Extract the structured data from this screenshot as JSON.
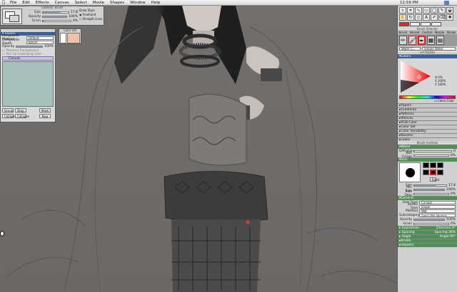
{
  "menubar": {
    "items": [
      "File",
      "Edit",
      "Effects",
      "Canvas",
      "Select",
      "Movie",
      "Shapes",
      "Window",
      "Help"
    ],
    "clock": "12:59 PM"
  },
  "brush_props": {
    "title": "Controls: Brush",
    "rows": [
      {
        "label": "Size",
        "value": "17.8"
      },
      {
        "label": "Opacity",
        "value": "100%"
      },
      {
        "label": "Grain",
        "value": "0%"
      }
    ],
    "draw_style": {
      "title": "Draw Style",
      "opt1": "Freehand",
      "opt2": "Straight Lines"
    }
  },
  "layers": {
    "title": "Layers",
    "composite_method": {
      "label": "Composite Method",
      "value": "Default"
    },
    "composite_depth": {
      "label": "Composite Depth",
      "value": "Ignore"
    },
    "opacity_label": "Opacity",
    "opacity_value": "100%",
    "preserve": "Preserve Transparency",
    "pick_up": "Pick Up Underlying Color",
    "layer_name": "Canvas",
    "buttons": [
      "Group",
      "Drop",
      "Mask",
      "Collapse",
      "Collapse",
      "New"
    ]
  },
  "color_set": {
    "title": "Color Set"
  },
  "right": {
    "palette_title": "Brush Selector",
    "brush_tabs": [
      "Brush",
      "Variant",
      "Control",
      "Nozzle",
      "Stroke"
    ],
    "brush_category": "Water C...",
    "brush_variant": "Simple Water",
    "art_palette": "Art Palette",
    "colors_title": "Colors",
    "hsv": [
      "H 0%",
      "S 100%",
      "V 100%"
    ],
    "clone_color": "Clone Color",
    "sections": [
      "Papers",
      "Gradients",
      "Patterns",
      "Weaves",
      "RGB Color",
      "Color Set",
      "Color Variability",
      "Nozzles",
      "Looks"
    ],
    "brush_controls": "Brush Controls",
    "water_title": "Water",
    "diffusion": {
      "label": "Diffusion",
      "value": "0"
    },
    "wet_fringe": {
      "label": "Wet Fringe",
      "value": "0%"
    },
    "size_title": "Size",
    "size_rows": [
      {
        "label": "Size",
        "value": "17.8"
      },
      {
        "label": "Min Size",
        "value": "100%"
      },
      {
        "label": "Size Step",
        "value": "0%"
      }
    ],
    "build": "Build",
    "general_title": "General",
    "general_rows": [
      {
        "label": "Dab Type",
        "value": "Circular"
      },
      {
        "label": "Stroke Type",
        "value": "Single"
      },
      {
        "label": "Method",
        "value": "Wet"
      },
      {
        "label": "Subcategory",
        "value": "Grainy Wet Abrasive"
      }
    ],
    "general_sliders": [
      {
        "label": "Opacity",
        "value": "100%"
      },
      {
        "label": "Grain",
        "value": "0%"
      }
    ],
    "bottom_sections": [
      {
        "label": "Expression",
        "value": "Direction 0°"
      },
      {
        "label": "Spacing",
        "value": "Spacing 36%"
      },
      {
        "label": "Angle",
        "value": "Angle 90°"
      },
      {
        "label": "Bristle",
        "value": ""
      },
      {
        "label": "Impasto",
        "value": ""
      }
    ]
  }
}
